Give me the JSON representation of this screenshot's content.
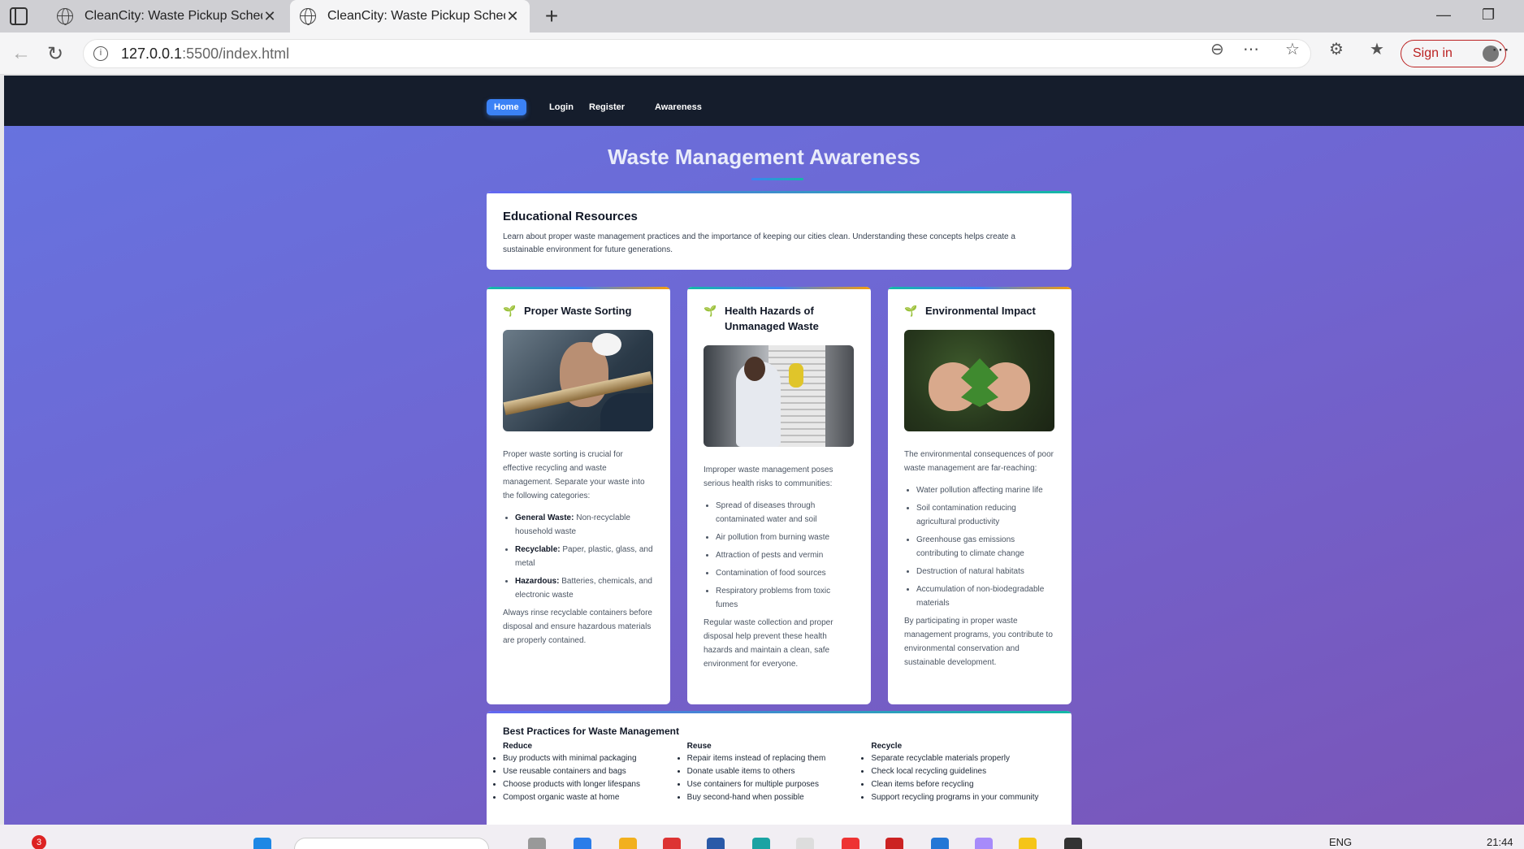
{
  "browser": {
    "tabs": [
      {
        "title": "CleanCity: Waste Pickup Schedule"
      },
      {
        "title": "CleanCity: Waste Pickup Schedule"
      }
    ],
    "url_host": "127.0.0.1",
    "url_path": ":5500/index.html",
    "signin_label": "Sign in"
  },
  "nav": {
    "home": "Home",
    "login": "Login",
    "register": "Register",
    "awareness": "Awareness"
  },
  "page_title": "Waste Management Awareness",
  "intro": {
    "heading": "Educational Resources",
    "text": "Learn about proper waste management practices and the importance of keeping our cities clean. Understanding these concepts helps create a sustainable environment for future generations."
  },
  "columns": [
    {
      "title": "Proper Waste Sorting",
      "intro": "Proper waste sorting is crucial for effective recycling and waste management. Separate your waste into the following categories:",
      "items": [
        {
          "label": "General Waste:",
          "text": " Non-recyclable household waste"
        },
        {
          "label": "Recyclable:",
          "text": " Paper, plastic, glass, and metal"
        },
        {
          "label": "Hazardous:",
          "text": " Batteries, chemicals, and electronic waste"
        }
      ],
      "after": "Always rinse recyclable containers before disposal and ensure hazardous materials are properly contained."
    },
    {
      "title": "Health Hazards of Unmanaged Waste",
      "intro": "Improper waste management poses serious health risks to communities:",
      "items": [
        {
          "text": "Spread of diseases through contaminated water and soil"
        },
        {
          "text": "Air pollution from burning waste"
        },
        {
          "text": "Attraction of pests and vermin"
        },
        {
          "text": "Contamination of food sources"
        },
        {
          "text": "Respiratory problems from toxic fumes"
        }
      ],
      "after": "Regular waste collection and proper disposal help prevent these health hazards and maintain a clean, safe environment for everyone."
    },
    {
      "title": "Environmental Impact",
      "intro": "The environmental consequences of poor waste management are far-reaching:",
      "items": [
        {
          "text": "Water pollution affecting marine life"
        },
        {
          "text": "Soil contamination reducing agricultural productivity"
        },
        {
          "text": "Greenhouse gas emissions contributing to climate change"
        },
        {
          "text": "Destruction of natural habitats"
        },
        {
          "text": "Accumulation of non-biodegradable materials"
        }
      ],
      "after": "By participating in proper waste management programs, you contribute to environmental conservation and sustainable development."
    }
  ],
  "best_practices": {
    "heading": "Best Practices for Waste Management",
    "groups": [
      {
        "title": "Reduce",
        "items": [
          "Buy products with minimal packaging",
          "Use reusable containers and bags",
          "Choose products with longer lifespans",
          "Compost organic waste at home"
        ]
      },
      {
        "title": "Reuse",
        "items": [
          "Repair items instead of replacing them",
          "Donate usable items to others",
          "Use containers for multiple purposes",
          "Buy second-hand when possible"
        ]
      },
      {
        "title": "Recycle",
        "items": [
          "Separate recyclable materials properly",
          "Check local recycling guidelines",
          "Clean items before recycling",
          "Support recycling programs in your community"
        ]
      }
    ]
  },
  "taskbar": {
    "notification_count": "3",
    "language": "ENG",
    "time": "21:44"
  }
}
